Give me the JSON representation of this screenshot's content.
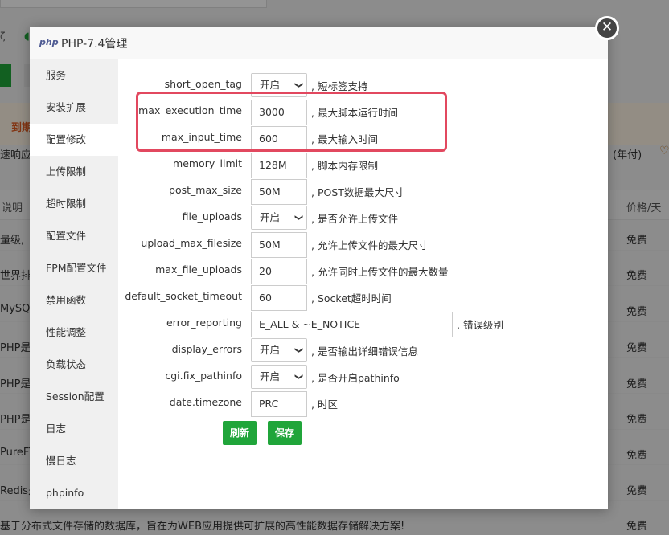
{
  "dialog": {
    "title": "PHP-7.4管理",
    "logo": "php",
    "close_icon": "✕"
  },
  "sidebar": {
    "items": [
      "服务",
      "安装扩展",
      "配置修改",
      "上传限制",
      "超时限制",
      "配置文件",
      "FPM配置文件",
      "禁用函数",
      "性能调整",
      "负载状态",
      "Session配置",
      "日志",
      "慢日志",
      "phpinfo"
    ],
    "active_index": 2
  },
  "fields": [
    {
      "label": "short_open_tag",
      "type": "select",
      "value": "开启",
      "desc": ", 短标签支持"
    },
    {
      "label": "max_execution_time",
      "type": "input",
      "value": "3000",
      "desc": ", 最大脚本运行时间"
    },
    {
      "label": "max_input_time",
      "type": "input",
      "value": "600",
      "desc": ", 最大输入时间"
    },
    {
      "label": "memory_limit",
      "type": "input",
      "value": "128M",
      "desc": ", 脚本内存限制"
    },
    {
      "label": "post_max_size",
      "type": "input",
      "value": "50M",
      "desc": ", POST数据最大尺寸"
    },
    {
      "label": "file_uploads",
      "type": "select",
      "value": "开启",
      "desc": ", 是否允许上传文件"
    },
    {
      "label": "upload_max_filesize",
      "type": "input",
      "value": "50M",
      "desc": ", 允许上传文件的最大尺寸"
    },
    {
      "label": "max_file_uploads",
      "type": "input",
      "value": "20",
      "desc": ", 允许同时上传文件的最大数量"
    },
    {
      "label": "default_socket_timeout",
      "type": "input",
      "value": "60",
      "desc": ", Socket超时时间"
    },
    {
      "label": "error_reporting",
      "type": "input_wide",
      "value": "E_ALL & ~E_NOTICE",
      "desc": ", 错误级别"
    },
    {
      "label": "display_errors",
      "type": "select",
      "value": "开启",
      "desc": ", 是否输出详细错误信息"
    },
    {
      "label": "cgi.fix_pathinfo",
      "type": "select",
      "value": "开启",
      "desc": ", 是否开启pathinfo"
    },
    {
      "label": "date.timezone",
      "type": "input",
      "value": "PRC",
      "desc": ", 时区"
    }
  ],
  "buttons": {
    "refresh": "刷新",
    "save": "保存"
  },
  "background": {
    "alert": "到期",
    "response": "速响应",
    "year": "(年付)",
    "col_left": "说明",
    "col_right": "价格/天",
    "rows_left": [
      "量级,",
      "世界排名",
      "MySQL",
      "PHP是世",
      "PHP是世",
      "PHP是世",
      "PureFTP",
      "Redis是"
    ],
    "rows_right": [
      "免费",
      "免费",
      "免费",
      "免费",
      "免费",
      "免费",
      "免费",
      "免费",
      "免费"
    ],
    "bottom": "基于分布式文件存储的数据库，旨在为WEB应用提供可扩展的高性能数据存储解决方案!"
  },
  "colors": {
    "accent": "#20a53a",
    "highlight": "#e2485f",
    "alert_text": "#e15a1f"
  }
}
